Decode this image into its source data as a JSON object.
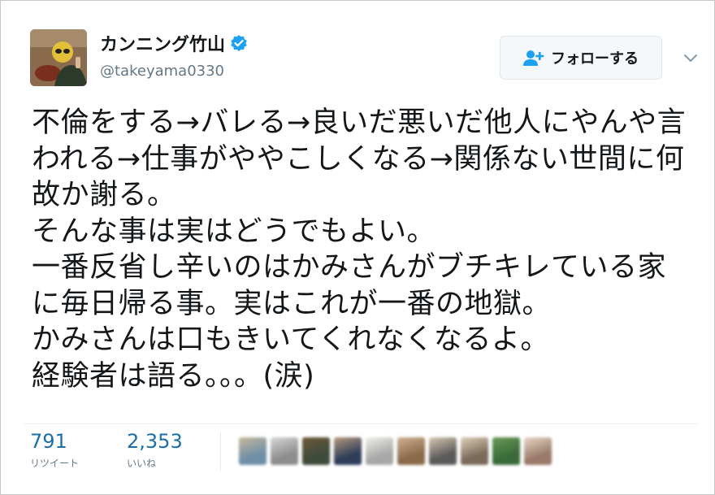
{
  "user": {
    "display_name": "カンニング竹山",
    "screen_name": "@takeyama0330",
    "verified": true,
    "avatar_icon": "user-avatar-photo"
  },
  "follow_button": {
    "label": "フォローする",
    "icon": "add-user-icon"
  },
  "menu": {
    "icon": "chevron-down-icon"
  },
  "tweet": {
    "text": "不倫をする→バレる→良いだ悪いだ他人にやんや言われる→仕事がややこしくなる→関係ない世間に何故か謝る。\nそんな事は実はどうでもよい。\n一番反省し辛いのはかみさんがブチキレている家に毎日帰る事。実はこれが一番の地獄。\nかみさんは口もきいてくれなくなるよ。\n経験者は語る。。。(涙)"
  },
  "stats": {
    "retweets": {
      "count": "791",
      "label": "リツイート"
    },
    "likes": {
      "count": "2,353",
      "label": "いいね"
    }
  },
  "likers": [
    {
      "color": "#6f8fa8",
      "accent": "#c8b89a"
    },
    {
      "color": "#8d8d8d",
      "accent": "#d8d8d8"
    },
    {
      "color": "#3e4a3a",
      "accent": "#6e5a3a"
    },
    {
      "color": "#2e3e5a",
      "accent": "#b89a7a"
    },
    {
      "color": "#a8a8a8",
      "accent": "#f2efe8"
    },
    {
      "color": "#8a6a4a",
      "accent": "#d0b090"
    },
    {
      "color": "#5a5a5a",
      "accent": "#d8c8b0"
    },
    {
      "color": "#7a6a5a",
      "accent": "#e0d0b8"
    },
    {
      "color": "#3a6a3a",
      "accent": "#6a9a5a"
    },
    {
      "color": "#9a7a6a",
      "accent": "#e8d8c8"
    }
  ],
  "colors": {
    "accent_blue": "#1da1f2",
    "count_blue": "#1b6fa8",
    "muted_gray": "#657786"
  }
}
